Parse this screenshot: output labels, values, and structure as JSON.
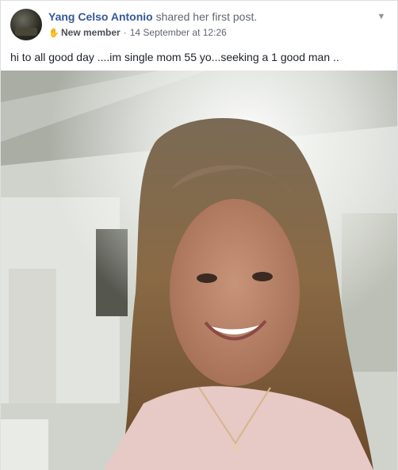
{
  "post": {
    "author": "Yang Celso Antonio",
    "action": "shared her first post.",
    "badge": "New member",
    "separator": "·",
    "timestamp": "14 September at 12:26",
    "text": "hi to all good day ....im single mom 55 yo...seeking a 1 good man ..",
    "icons": {
      "badge": "wave-icon",
      "menu": "chevron-down-icon",
      "avatar": "profile-photo"
    },
    "colors": {
      "author_link": "#365899",
      "meta_text": "#606770",
      "body_text": "#1d2129"
    }
  }
}
